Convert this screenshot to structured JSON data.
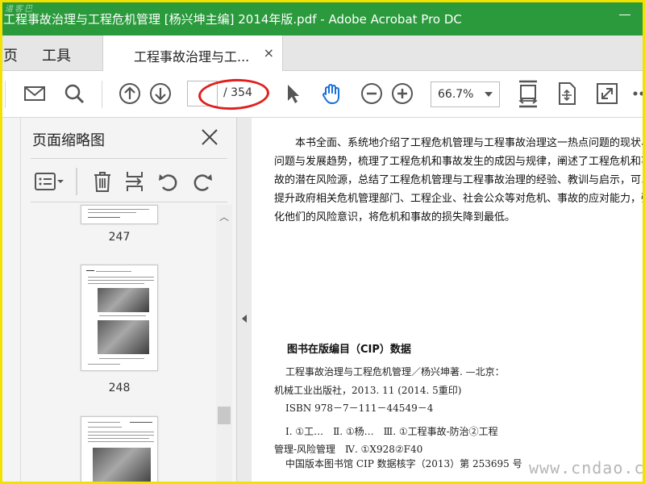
{
  "window": {
    "title": "工程事故治理与工程危机管理 [杨兴坤主编] 2014年版.pdf - Adobe Acrobat Pro DC",
    "corner_watermark": "道客巴"
  },
  "menubar": {
    "home_partial": "页",
    "tools": "工具",
    "doc_tab_label": "工程事故治理与工...",
    "doc_tab_close": "×"
  },
  "toolbar": {
    "icons": [
      "mail-icon",
      "search-icon",
      "prev-page-icon",
      "next-page-icon",
      "select-arrow-icon",
      "hand-tool-icon",
      "zoom-out-icon",
      "zoom-in-icon",
      "fit-page-icon",
      "scroll-mode-icon",
      "fullscreen-icon"
    ],
    "page_current": "",
    "page_total": "/ 354",
    "zoom": "66.7%",
    "annotation_color": "#e02020"
  },
  "thumbnail_panel": {
    "title": "页面缩略图",
    "pages": [
      {
        "number": "247"
      },
      {
        "number": "248"
      }
    ]
  },
  "document": {
    "intro": "本书全面、系统地介绍了工程危机管理与工程事故治理这一热点问题的现状、问题与发展趋势，梳理了工程危机和事故发生的成因与规律，阐述了工程危机和事故的潜在风险源，总结了工程危机管理与工程事故治理的经验、教训与启示，可以提升政府相关危机管理部门、工程企业、社会公众等对危机、事故的应对能力，强化他们的风险意识，将危机和事故的损失降到最低。",
    "cip_title": "图书在版编目（CIP）数据",
    "cip_line1": "工程事故治理与工程危机管理／杨兴坤著. —北京：",
    "cip_line2": "机械工业出版社，2013. 11 (2014. 5重印)",
    "cip_line3": "ISBN 978－7－111－44549－4",
    "cip_line4": "Ⅰ. ①工…　Ⅱ. ①杨…　Ⅲ. ①工程事故-防治②工程",
    "cip_line5": "管理-风险管理　Ⅳ. ①X928②F40",
    "cip_footer": "中国版本图书馆 CIP 数据核字（2013）第 253695 号"
  },
  "watermark": "www.cndao.com",
  "colors": {
    "titlebar": "#2a9a3c",
    "frame": "#f2e200",
    "hand_tool": "#1a6fd8"
  }
}
